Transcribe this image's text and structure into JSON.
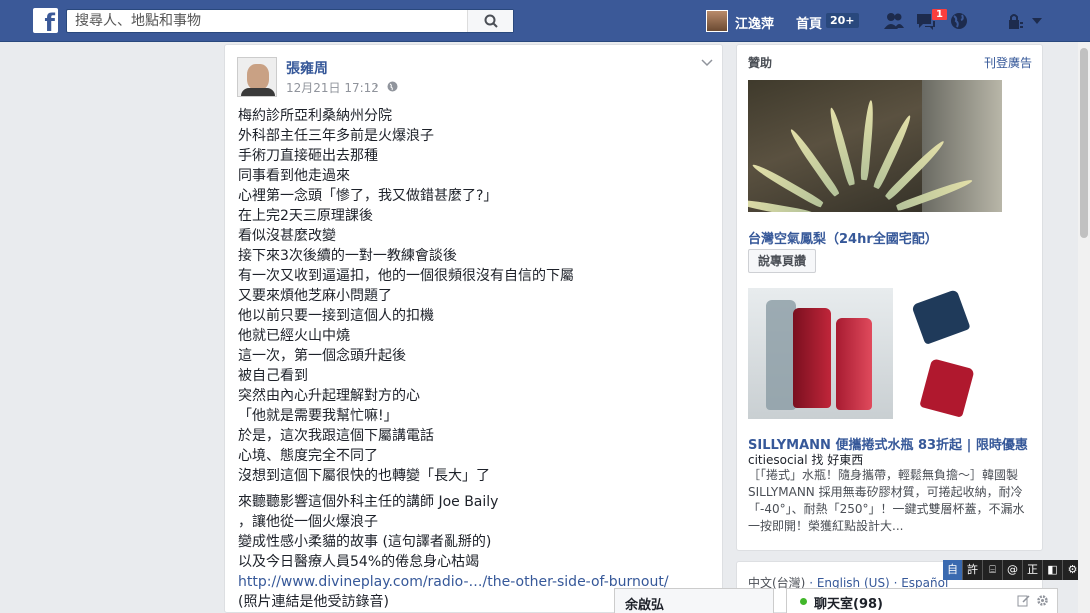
{
  "topbar": {
    "logo_letter": "f",
    "search_placeholder": "搜尋人、地點和事物",
    "user_name": "江逸萍",
    "home_label": "首頁",
    "home_count": "20+",
    "notification_count": "1"
  },
  "post": {
    "author": "張雍周",
    "time": "12月21日 17:12",
    "dot": "·",
    "lines": [
      "梅約診所亞利桑納州分院",
      "外科部主任三年多前是火爆浪子",
      "手術刀直接砸出去那種",
      "同事看到他走過來",
      "心裡第一念頭「慘了，我又做錯甚麼了?」",
      "在上完2天三原理課後",
      "看似沒甚麼改變",
      "接下來3次後續的一對一教練會談後",
      "有一次又收到逼逼扣，他的一個很頻很沒有自信的下屬",
      "又要來煩他芝麻小問題了",
      "他以前只要一接到這個人的扣機",
      "他就已經火山中燒",
      "這一次，第一個念頭升起後",
      "被自己看到",
      "突然由內心升起理解對方的心",
      "「他就是需要我幫忙嘛!」",
      "於是，這次我跟這個下屬講電話",
      "心境、態度完全不同了",
      "沒想到這個下屬很快的也轉變「長大」了"
    ],
    "lines2": [
      "來聽聽影響這個外科主任的講師 Joe Baily",
      "，讓他從一個火爆浪子",
      "變成性感小柔貓的故事 (這句譯者亂掰的)",
      "以及今日醫療人員54%的倦怠身心枯竭"
    ],
    "link": "http://www.divineplay.com/radio-…/the-other-side-of-burnout/",
    "last_line": "(照片連結是他受訪錄音)"
  },
  "ads": {
    "title": "贊助",
    "create_ad": "刊登廣告",
    "ad1": {
      "link": "台灣空氣鳳梨（24hr全國宅配）",
      "button": "說專頁讚"
    },
    "ad2": {
      "link": "SILLYMANN 便攜捲式水瓶 83折起 | 限時優惠",
      "sub": "citiesocial 找 好東西",
      "desc": "［「捲式」水瓶！隨身攜帶，輕鬆無負擔～］韓國製 SILLYMANN 採用無毒矽膠材質，可捲起收納，耐冷「-40°」、耐熱「250°」！一鍵式雙層杯蓋，不漏水一按即開！榮獲紅點設計大..."
    }
  },
  "footer": {
    "lang_current": "中文(台灣)",
    "lang_sep": " · ",
    "lang_2": "English (US)",
    "lang_3": "Español"
  },
  "ime": {
    "buttons": [
      "自",
      "許",
      "⌸",
      "@",
      "正",
      "◧",
      "⚙"
    ]
  },
  "chat": {
    "user_tab": "余啟弘",
    "room_label": "聊天室(98)"
  },
  "colors": {
    "brand": "#3b5998",
    "link": "#365899",
    "online": "#42b72a",
    "badge": "#fa3e3e"
  }
}
